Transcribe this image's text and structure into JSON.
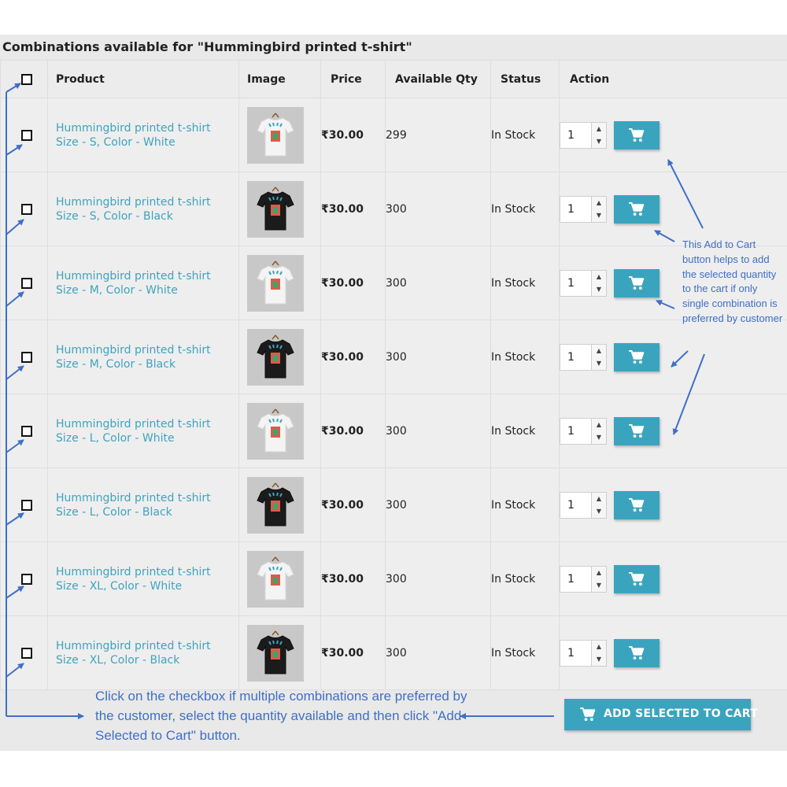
{
  "title": "Combinations available for \"Hummingbird printed t-shirt\"",
  "columns": [
    "Product",
    "Image",
    "Price",
    "Available Qty",
    "Status",
    "Action"
  ],
  "rows": [
    {
      "name": "Hummingbird printed t-shirt",
      "variant": "Size - S, Color - White",
      "shirt": "white",
      "price": "₹30.00",
      "qty": "299",
      "status": "In Stock",
      "quantity": "1"
    },
    {
      "name": "Hummingbird printed t-shirt",
      "variant": "Size - S, Color - Black",
      "shirt": "black",
      "price": "₹30.00",
      "qty": "300",
      "status": "In Stock",
      "quantity": "1"
    },
    {
      "name": "Hummingbird printed t-shirt",
      "variant": "Size - M, Color - White",
      "shirt": "white",
      "price": "₹30.00",
      "qty": "300",
      "status": "In Stock",
      "quantity": "1"
    },
    {
      "name": "Hummingbird printed t-shirt",
      "variant": "Size - M, Color - Black",
      "shirt": "black",
      "price": "₹30.00",
      "qty": "300",
      "status": "In Stock",
      "quantity": "1"
    },
    {
      "name": "Hummingbird printed t-shirt",
      "variant": "Size - L, Color - White",
      "shirt": "white",
      "price": "₹30.00",
      "qty": "300",
      "status": "In Stock",
      "quantity": "1"
    },
    {
      "name": "Hummingbird printed t-shirt",
      "variant": "Size - L, Color - Black",
      "shirt": "black",
      "price": "₹30.00",
      "qty": "300",
      "status": "In Stock",
      "quantity": "1"
    },
    {
      "name": "Hummingbird printed t-shirt",
      "variant": "Size - XL, Color - White",
      "shirt": "white",
      "price": "₹30.00",
      "qty": "300",
      "status": "In Stock",
      "quantity": "1"
    },
    {
      "name": "Hummingbird printed t-shirt",
      "variant": "Size - XL, Color - Black",
      "shirt": "black",
      "price": "₹30.00",
      "qty": "300",
      "status": "In Stock",
      "quantity": "1"
    }
  ],
  "add_selected_label": "ADD SELECTED TO CART",
  "annotations": {
    "add_to_cart_note": "This Add to Cart button helps to add the selected quantity to the cart if only single combination is preferred by customer",
    "checkbox_note": "Click on the checkbox if multiple combinations are preferred by the customer, select the quantity available and then click \"Add Selected to Cart\" button."
  },
  "icons": {
    "cart": "cart-icon",
    "spin_up": "spin-up-icon",
    "spin_down": "spin-down-icon",
    "checkbox": "checkbox-icon"
  },
  "colors": {
    "accent": "#3aa4bf",
    "link": "#3fa3bd",
    "price": "#e07b3c",
    "annotation": "#3f6fc6",
    "panel": "#e9e9e9"
  }
}
